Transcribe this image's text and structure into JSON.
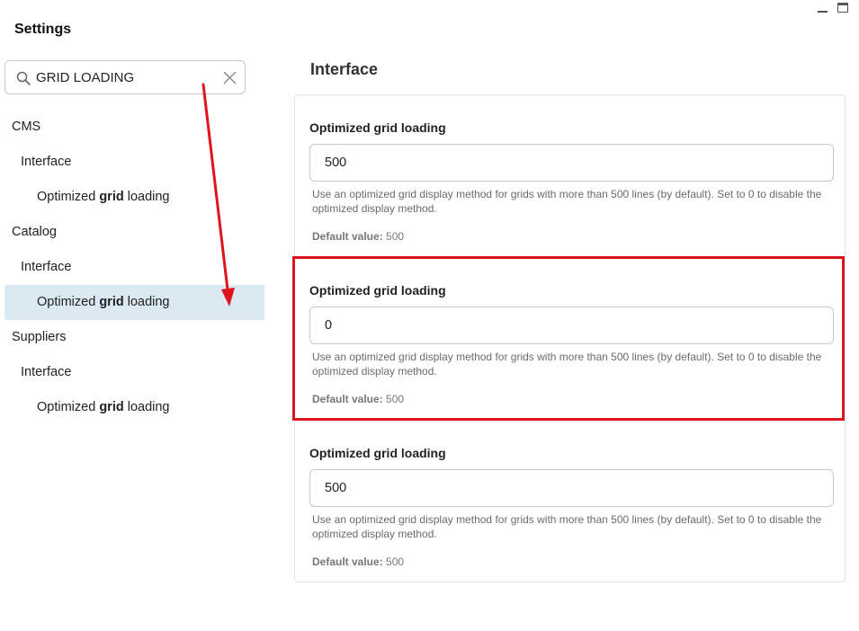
{
  "app": {
    "title": "Settings"
  },
  "search": {
    "value": "GRID LOADING"
  },
  "tree": {
    "cms": {
      "label": "CMS",
      "interface": "Interface",
      "item_pre": "Optimized ",
      "item_bold": "grid",
      "item_post": " loading"
    },
    "catalog": {
      "label": "Catalog",
      "interface": "Interface",
      "item_pre": "Optimized ",
      "item_bold": "grid",
      "item_post": " loading"
    },
    "suppliers": {
      "label": "Suppliers",
      "interface": "Interface",
      "item_pre": "Optimized ",
      "item_bold": "grid",
      "item_post": " loading"
    }
  },
  "main": {
    "section_title": "Interface",
    "settings": [
      {
        "label": "Optimized grid loading",
        "value": "500",
        "help": "Use an optimized grid display method for grids with more than 500 lines (by default). Set to 0 to disable the optimized display method.",
        "default_label": "Default value:",
        "default_value": "500"
      },
      {
        "label": "Optimized grid loading",
        "value": "0",
        "help": "Use an optimized grid display method for grids with more than 500 lines (by default). Set to 0 to disable the optimized display method.",
        "default_label": "Default value:",
        "default_value": "500"
      },
      {
        "label": "Optimized grid loading",
        "value": "500",
        "help": "Use an optimized grid display method for grids with more than 500 lines (by default). Set to 0 to disable the optimized display method.",
        "default_label": "Default value:",
        "default_value": "500"
      }
    ]
  },
  "colors": {
    "highlight": "#e0141b",
    "selected_row": "#dbe9f3"
  },
  "icons": {
    "search": "search-icon",
    "clear": "close-icon",
    "minimize": "minimize-icon",
    "maximize": "maximize-icon"
  }
}
